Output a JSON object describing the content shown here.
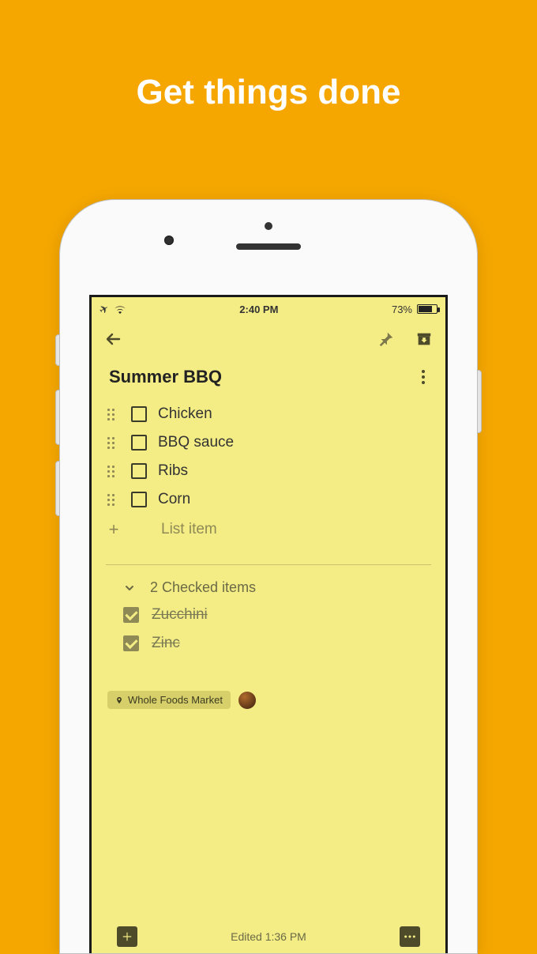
{
  "hero": {
    "headline": "Get things done"
  },
  "status": {
    "time": "2:40 PM",
    "battery_pct": "73%"
  },
  "note": {
    "title": "Summer BBQ",
    "items": [
      {
        "label": "Chicken"
      },
      {
        "label": "BBQ sauce"
      },
      {
        "label": "Ribs"
      },
      {
        "label": "Corn"
      }
    ],
    "add_placeholder": "List item",
    "checked_header": "2 Checked items",
    "checked_items": [
      {
        "label": "Zucchini"
      },
      {
        "label": "Zinc"
      }
    ],
    "location_chip": "Whole Foods Market",
    "edited": "Edited 1:36 PM"
  }
}
